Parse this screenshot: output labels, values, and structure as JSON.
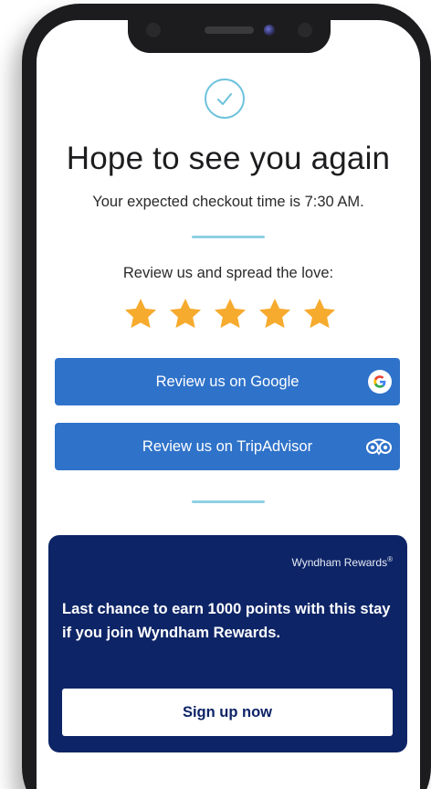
{
  "confirmation": {
    "icon": "checkmark-circle-icon",
    "title": "Hope to see you again",
    "subtitle": "Your expected checkout time is 7:30 AM."
  },
  "review": {
    "prompt": "Review us and spread the love:",
    "rating": 5,
    "max_rating": 5,
    "star_color": "#f6ab2e",
    "buttons": [
      {
        "label": "Review us on Google",
        "icon": "google-icon"
      },
      {
        "label": "Review us on TripAdvisor",
        "icon": "tripadvisor-icon"
      }
    ],
    "button_color": "#2f72c9"
  },
  "rewards": {
    "brand": "Wyndham Rewards",
    "brand_mark": "®",
    "message": "Last chance to earn 1000 points with this stay if you join Wyndham Rewards.",
    "cta_label": "Sign up now",
    "card_color": "#0d2466"
  },
  "accent_color": "#6cc2dd"
}
